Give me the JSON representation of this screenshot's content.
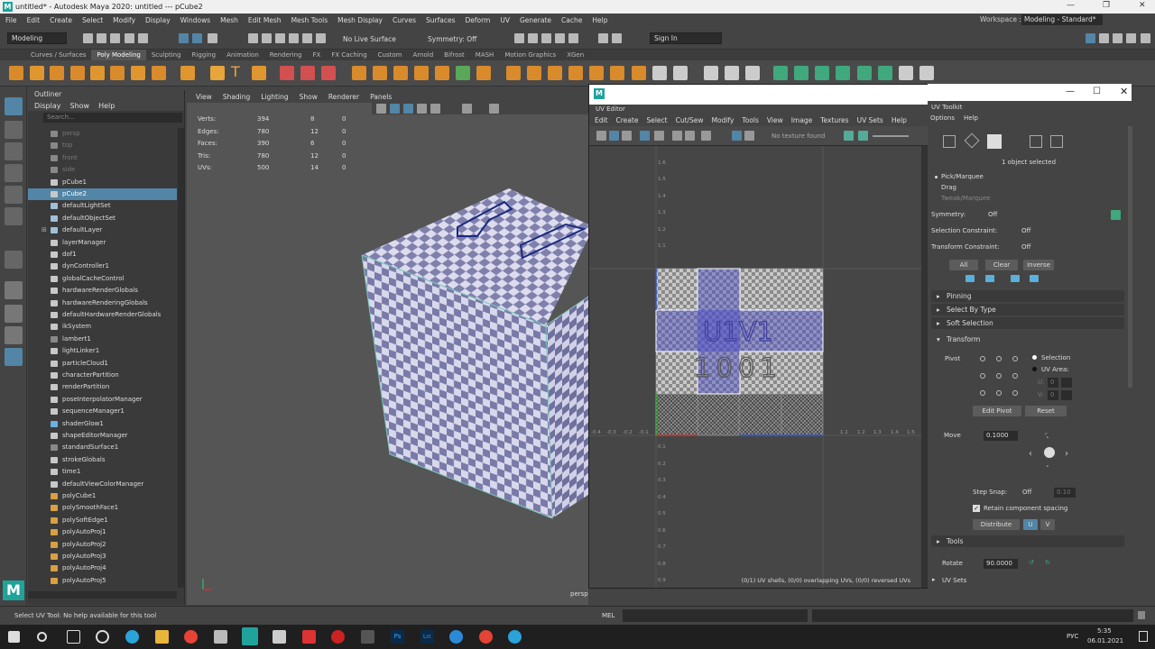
{
  "window": {
    "title": "untitled* - Autodesk Maya 2020: untitled   ---   pCube2",
    "logo": "M"
  },
  "menubar": [
    "File",
    "Edit",
    "Create",
    "Select",
    "Modify",
    "Display",
    "Windows",
    "Mesh",
    "Edit Mesh",
    "Mesh Tools",
    "Mesh Display",
    "Curves",
    "Surfaces",
    "Deform",
    "UV",
    "Generate",
    "Cache",
    "Help"
  ],
  "workspace": {
    "label": "Workspace :",
    "value": "Modeling - Standard*"
  },
  "status": {
    "mode": "Modeling",
    "live_surface": "No Live Surface",
    "symmetry": "Symmetry: Off",
    "sign_in": "Sign In"
  },
  "shelf_tabs": [
    "Curves / Surfaces",
    "Poly Modeling",
    "Sculpting",
    "Rigging",
    "Animation",
    "Rendering",
    "FX",
    "FX Caching",
    "Custom",
    "Arnold",
    "Bifrost",
    "MASH",
    "Motion Graphics",
    "XGen"
  ],
  "shelf_active": "Poly Modeling",
  "outliner": {
    "title": "Outliner",
    "menu": [
      "Display",
      "Show",
      "Help"
    ],
    "search_placeholder": "Search...",
    "items": [
      {
        "label": "persp",
        "dim": true,
        "color": "#888"
      },
      {
        "label": "top",
        "dim": true,
        "color": "#888"
      },
      {
        "label": "front",
        "dim": true,
        "color": "#888"
      },
      {
        "label": "side",
        "dim": true,
        "color": "#888"
      },
      {
        "label": "pCube1",
        "dim": false,
        "color": "#c8c8c8"
      },
      {
        "label": "pCube2",
        "dim": false,
        "color": "#c8c8c8",
        "selected": true
      },
      {
        "label": "defaultLightSet",
        "dim": false,
        "color": "#9fc0d8"
      },
      {
        "label": "defaultObjectSet",
        "dim": false,
        "color": "#9fc0d8"
      },
      {
        "label": "defaultLayer",
        "dim": false,
        "color": "#9fc0d8"
      },
      {
        "label": "layerManager",
        "dim": false,
        "color": "#c8c8c8"
      },
      {
        "label": "dof1",
        "dim": false,
        "color": "#c8c8c8"
      },
      {
        "label": "dynController1",
        "dim": false,
        "color": "#c8c8c8"
      },
      {
        "label": "globalCacheControl",
        "dim": false,
        "color": "#c8c8c8"
      },
      {
        "label": "hardwareRenderGlobals",
        "dim": false,
        "color": "#c8c8c8"
      },
      {
        "label": "hardwareRenderingGlobals",
        "dim": false,
        "color": "#c8c8c8"
      },
      {
        "label": "defaultHardwareRenderGlobals",
        "dim": false,
        "color": "#c8c8c8"
      },
      {
        "label": "ikSystem",
        "dim": false,
        "color": "#c8c8c8"
      },
      {
        "label": "lambert1",
        "dim": false,
        "color": "#888"
      },
      {
        "label": "lightLinker1",
        "dim": false,
        "color": "#c8c8c8"
      },
      {
        "label": "particleCloud1",
        "dim": false,
        "color": "#c8c8c8"
      },
      {
        "label": "characterPartition",
        "dim": false,
        "color": "#c8c8c8"
      },
      {
        "label": "renderPartition",
        "dim": false,
        "color": "#c8c8c8"
      },
      {
        "label": "poseInterpolatorManager",
        "dim": false,
        "color": "#c8c8c8"
      },
      {
        "label": "sequenceManager1",
        "dim": false,
        "color": "#c8c8c8"
      },
      {
        "label": "shaderGlow1",
        "dim": false,
        "color": "#6ab0e0"
      },
      {
        "label": "shapeEditorManager",
        "dim": false,
        "color": "#c8c8c8"
      },
      {
        "label": "standardSurface1",
        "dim": false,
        "color": "#888"
      },
      {
        "label": "strokeGlobals",
        "dim": false,
        "color": "#c8c8c8"
      },
      {
        "label": "time1",
        "dim": false,
        "color": "#c8c8c8"
      },
      {
        "label": "defaultViewColorManager",
        "dim": false,
        "color": "#c8c8c8"
      },
      {
        "label": "polyCube1",
        "dim": false,
        "color": "#d8a040"
      },
      {
        "label": "polySmoothFace1",
        "dim": false,
        "color": "#d8a040"
      },
      {
        "label": "polySoftEdge1",
        "dim": false,
        "color": "#d8a040"
      },
      {
        "label": "polyAutoProj1",
        "dim": false,
        "color": "#d8a040"
      },
      {
        "label": "polyAutoProj2",
        "dim": false,
        "color": "#d8a040"
      },
      {
        "label": "polyAutoProj3",
        "dim": false,
        "color": "#d8a040"
      },
      {
        "label": "polyAutoProj4",
        "dim": false,
        "color": "#d8a040"
      },
      {
        "label": "polyAutoProj5",
        "dim": false,
        "color": "#d8a040"
      }
    ]
  },
  "viewport": {
    "menu": [
      "View",
      "Shading",
      "Lighting",
      "Show",
      "Renderer",
      "Panels"
    ],
    "camera": "persp",
    "hud": [
      {
        "label": "Verts:",
        "a": "394",
        "b": "8",
        "c": "0"
      },
      {
        "label": "Edges:",
        "a": "780",
        "b": "12",
        "c": "0"
      },
      {
        "label": "Faces:",
        "a": "390",
        "b": "6",
        "c": "0"
      },
      {
        "label": "Tris:",
        "a": "780",
        "b": "12",
        "c": "0"
      },
      {
        "label": "UVs:",
        "a": "500",
        "b": "14",
        "c": "0"
      }
    ]
  },
  "uv_editor": {
    "window_logo": "M",
    "header": "UV Editor",
    "menu": [
      "Edit",
      "Create",
      "Select",
      "Cut/Sew",
      "Modify",
      "Tools",
      "View",
      "Image",
      "Textures",
      "UV Sets",
      "Help"
    ],
    "texture": "No texture found",
    "tile_label_1": "U1V1",
    "tile_label_2": "1001",
    "status": "(0/1) UV shells, (0/0) overlapping UVs, (0/0) reversed UVs",
    "ticks_v": [
      "1.6",
      "1.5",
      "1.4",
      "1.3",
      "1.2",
      "1.1",
      "0.1",
      "0.2",
      "0.3",
      "0.4",
      "0.5",
      "0.6",
      "0.7",
      "0.8",
      "0.9"
    ],
    "ticks_u": [
      "-0.4",
      "-0.3",
      "-0.2",
      "-0.1",
      "1.1",
      "1.2",
      "1.3",
      "1.4",
      "1.5"
    ]
  },
  "uv_toolkit": {
    "header": "UV Toolkit",
    "menu": [
      "Options",
      "Help"
    ],
    "selected": "1 object selected",
    "modes": [
      "Pick/Marquee",
      "Drag",
      "Tweak/Marquee"
    ],
    "symmetry_label": "Symmetry:",
    "symmetry_value": "Off",
    "sel_constraint_label": "Selection Constraint:",
    "sel_constraint_value": "Off",
    "xf_constraint_label": "Transform Constraint:",
    "xf_constraint_value": "Off",
    "buttons": [
      "All",
      "Clear",
      "Inverse"
    ],
    "sections": [
      "Pinning",
      "Select By Type",
      "Soft Selection",
      "Transform"
    ],
    "pivot": "Pivot",
    "pivot_opts": [
      "Selection",
      "UV Area:"
    ],
    "u_label": "U:",
    "u_value": "0",
    "v_label": "V:",
    "v_value": "0",
    "edit_pivot": "Edit Pivot",
    "reset": "Reset",
    "move_label": "Move",
    "move_value": "0.1000",
    "step_snap_label": "Step Snap:",
    "step_snap_value": "Off",
    "step_snap_num": "0.10",
    "retain": "Retain component spacing",
    "distribute": "Distribute",
    "u_btn": "U",
    "v_btn": "V",
    "tools": "Tools",
    "rotate_label": "Rotate",
    "rotate_value": "90.0000",
    "uv_sets": "UV Sets"
  },
  "bottom": {
    "help": "Select UV Tool: No help available for this tool",
    "mel": "MEL"
  },
  "taskbar": {
    "time": "5:35",
    "date": "06.01.2021",
    "lang": "РУС"
  }
}
